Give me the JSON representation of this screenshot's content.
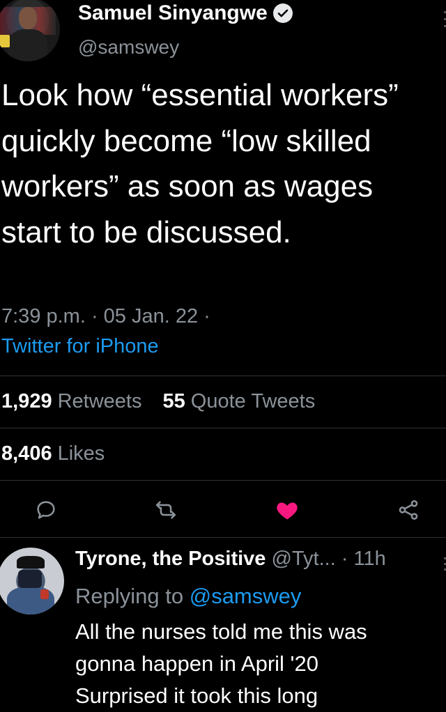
{
  "author": {
    "name": "Samuel Sinyangwe",
    "handle": "@samswey",
    "verified": true
  },
  "tweet": {
    "text": "Look how “essential workers” quickly become “low skilled workers” as soon as wages start to be discussed.",
    "meta": "7:39 p.m. · 05 Jan. 22 ·",
    "source": "Twitter for iPhone"
  },
  "stats": {
    "retweets_count": "1,929",
    "retweets_label": "Retweets",
    "quotes_count": "55",
    "quotes_label": "Quote Tweets",
    "likes_count": "8,406",
    "likes_label": "Likes"
  },
  "actions": {
    "reply_icon": "reply-icon",
    "retweet_icon": "retweet-icon",
    "like_icon": "heart-icon",
    "share_icon": "share-icon",
    "like_color": "#f91880"
  },
  "reply": {
    "name": "Tyrone, the Positive",
    "handle": "@Tyt...",
    "time": " · 11h",
    "replying_prefix": "Replying to",
    "replying_to": "@samswey",
    "text_lines": [
      "All the nurses told me this was",
      "gonna happen in April '20",
      "Surprised it took this long"
    ]
  },
  "colors": {
    "background": "#000000",
    "link": "#1d9bf0",
    "secondary": "#8b9299",
    "divider": "#2f3336"
  }
}
